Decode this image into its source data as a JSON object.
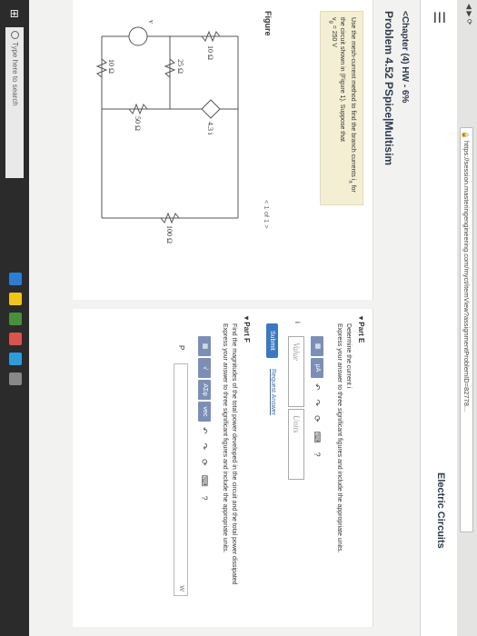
{
  "browser": {
    "url": "https://session.masteringengineering.com/myct/itemView?assignmentProblemID=82778..."
  },
  "header": {
    "course_title": "Electric Circuits"
  },
  "breadcrumb": "<Chapter (4) HW - 6%",
  "problem_title": "Problem 4.52 PSpice|Multisim",
  "instructions": {
    "line1": "Use the mesh-current method to find the branch currents i",
    "line2": "for the circuit shown in (Figure 1). Suppose that",
    "line3": "v",
    "line3b": " = 250  V",
    "sub_a": "a",
    "sub_g": "g"
  },
  "figure": {
    "label": "Figure",
    "pager": "< 1 of 1 >",
    "labels": {
      "r1": "10 Ω",
      "r2": "25 Ω",
      "r3": "10 Ω",
      "r4": "50 Ω",
      "r5": "100 Ω",
      "dep_source": "4.3 i",
      "vg": "v"
    }
  },
  "partE": {
    "heading": "Part E",
    "text1": "Determine the current i",
    "text2": "Express your answer to three significant figures and include the appropriate units.",
    "answer_label": "i",
    "value_placeholder": "Value",
    "units_placeholder": "Units",
    "submit": "Submit",
    "request": "Request Answer",
    "tool_mu": "μA",
    "help": "?"
  },
  "partF": {
    "heading": "Part F",
    "text1": "Find the magnitudes of the total power developed in the circuit and the total power dissipated",
    "text2": "Express your answer to three significant figures and include the appropriate units.",
    "answer_label": "P",
    "unit": "W",
    "tool_sqrt": "√",
    "tool_sigma": "ΑΣφ",
    "tool_vec": "vec",
    "help": "?"
  },
  "taskbar": {
    "search_placeholder": "Type here to search"
  }
}
